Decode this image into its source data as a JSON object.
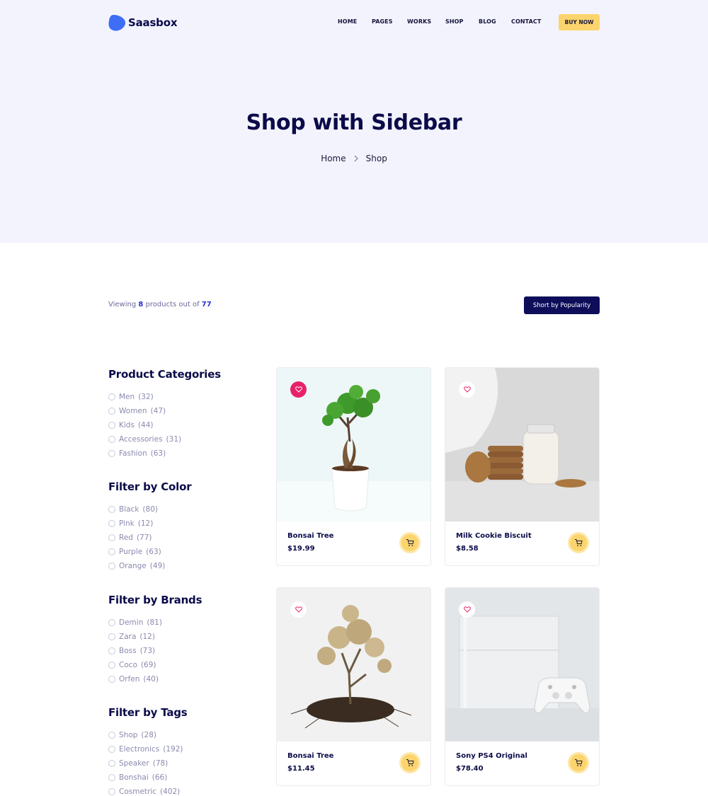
{
  "brand": {
    "name": "Saasbox",
    "color": "#3d6ef5"
  },
  "nav": {
    "items": [
      "HOME",
      "PAGES",
      "WORKS",
      "SHOP",
      "BLOG",
      "CONTACT"
    ],
    "cta": "BUY NOW"
  },
  "hero": {
    "title": "Shop with Sidebar",
    "breadcrumb": [
      "Home",
      "Shop"
    ]
  },
  "results": {
    "prefix": "Viewing",
    "shown": "8",
    "middle": "products out of",
    "total": "77",
    "sort_label": "Short by Popularity"
  },
  "filters": [
    {
      "title": "Product Categories",
      "items": [
        {
          "label": "Men",
          "count": "(32)"
        },
        {
          "label": "Women",
          "count": "(47)"
        },
        {
          "label": "Kids",
          "count": "(44)"
        },
        {
          "label": "Accessories",
          "count": "(31)"
        },
        {
          "label": "Fashion",
          "count": "(63)"
        }
      ]
    },
    {
      "title": "Filter by Color",
      "items": [
        {
          "label": "Black",
          "count": "(80)"
        },
        {
          "label": "Pink",
          "count": "(12)"
        },
        {
          "label": "Red",
          "count": "(77)"
        },
        {
          "label": "Purple",
          "count": "(63)"
        },
        {
          "label": "Orange",
          "count": "(49)"
        }
      ]
    },
    {
      "title": "Filter by Brands",
      "items": [
        {
          "label": "Demin",
          "count": "(81)"
        },
        {
          "label": "Zara",
          "count": "(12)"
        },
        {
          "label": "Boss",
          "count": "(73)"
        },
        {
          "label": "Coco",
          "count": "(69)"
        },
        {
          "label": "Orfen",
          "count": "(40)"
        }
      ]
    },
    {
      "title": "Filter by Tags",
      "items": [
        {
          "label": "Shop",
          "count": "(28)"
        },
        {
          "label": "Electronics",
          "count": "(192)"
        },
        {
          "label": "Speaker",
          "count": "(78)"
        },
        {
          "label": "Bonshai",
          "count": "(66)"
        },
        {
          "label": "Cosmetric",
          "count": "(402)"
        }
      ]
    }
  ],
  "products": [
    {
      "name": "Bonsai Tree",
      "price": "$19.99",
      "favorited": true,
      "image": "bonsai-tree-photo"
    },
    {
      "name": "Milk Cookie Biscuit",
      "price": "$8.58",
      "favorited": false,
      "image": "milk-cookies-photo"
    },
    {
      "name": "Bonsai Tree",
      "price": "$11.45",
      "favorited": false,
      "image": "dry-bonsai-photo"
    },
    {
      "name": "Sony PS4 Original",
      "price": "$78.40",
      "favorited": false,
      "image": "ps4-console-photo"
    }
  ],
  "colors": {
    "hero_bg": "#f3f3fd",
    "navy": "#0b0b4a",
    "cta_yellow": "#fcd46d",
    "accent_blue": "#2a2ad8",
    "favorite_pink": "#e8226a"
  },
  "icons": [
    "logo-icon",
    "chevron-right-icon",
    "heart-icon",
    "cart-icon",
    "radio-icon"
  ]
}
